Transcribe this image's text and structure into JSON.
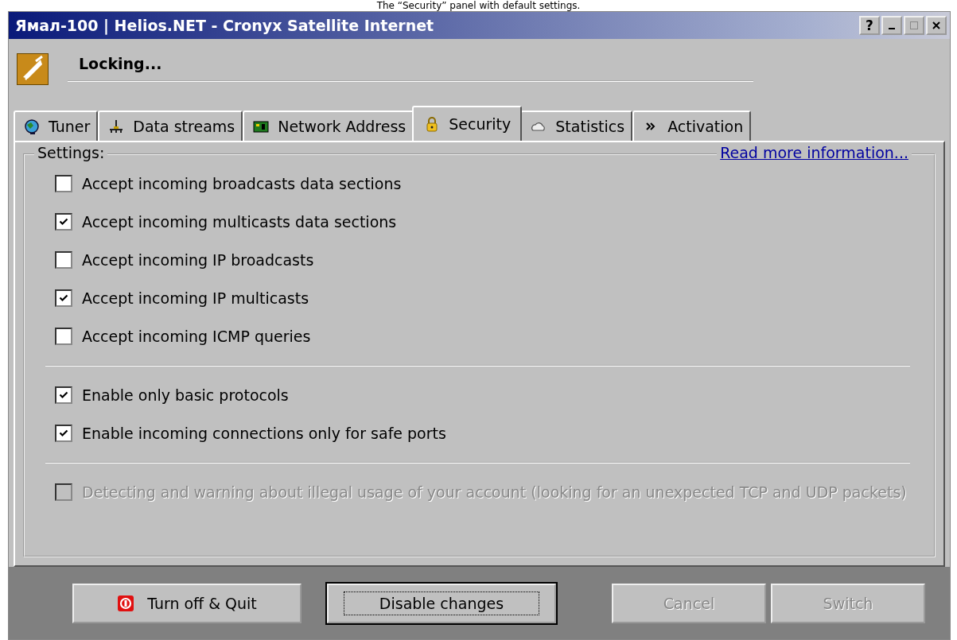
{
  "caption": "The “Security” panel with default settings.",
  "window": {
    "title": "Ямал-100 | Helios.NET - Cronyx Satellite Internet",
    "buttons": [
      "?"
    ]
  },
  "status": "Locking...",
  "tabs": [
    {
      "label": "Tuner",
      "selected": false
    },
    {
      "label": "Data streams",
      "selected": false
    },
    {
      "label": "Network Address",
      "selected": false
    },
    {
      "label": "Security",
      "selected": true
    },
    {
      "label": "Statistics",
      "selected": false
    },
    {
      "label": "Activation",
      "selected": false
    }
  ],
  "group": {
    "title": "Settings:",
    "link": "Read more information..."
  },
  "sections": [
    [
      {
        "label": "Accept incoming broadcasts data sections",
        "checked": false,
        "disabled": false
      },
      {
        "label": "Accept incoming multicasts data sections",
        "checked": true,
        "disabled": false
      },
      {
        "label": "Accept incoming IP broadcasts",
        "checked": false,
        "disabled": false
      },
      {
        "label": "Accept incoming IP multicasts",
        "checked": true,
        "disabled": false
      },
      {
        "label": "Accept incoming ICMP queries",
        "checked": false,
        "disabled": false
      }
    ],
    [
      {
        "label": "Enable only basic protocols",
        "checked": true,
        "disabled": false
      },
      {
        "label": "Enable incoming connections only for safe ports",
        "checked": true,
        "disabled": false
      }
    ],
    [
      {
        "label": "Detecting and warning about illegal usage of your account (looking for an unexpected TCP and UDP packets)",
        "checked": false,
        "disabled": true
      }
    ]
  ],
  "buttons": [
    {
      "label": "Turn off & Quit",
      "disabled": false,
      "default": false
    },
    {
      "label": "Disable changes",
      "disabled": false,
      "default": true
    },
    {
      "label": "Cancel",
      "disabled": true,
      "default": false
    },
    {
      "label": "Switch",
      "disabled": true,
      "default": false
    }
  ]
}
